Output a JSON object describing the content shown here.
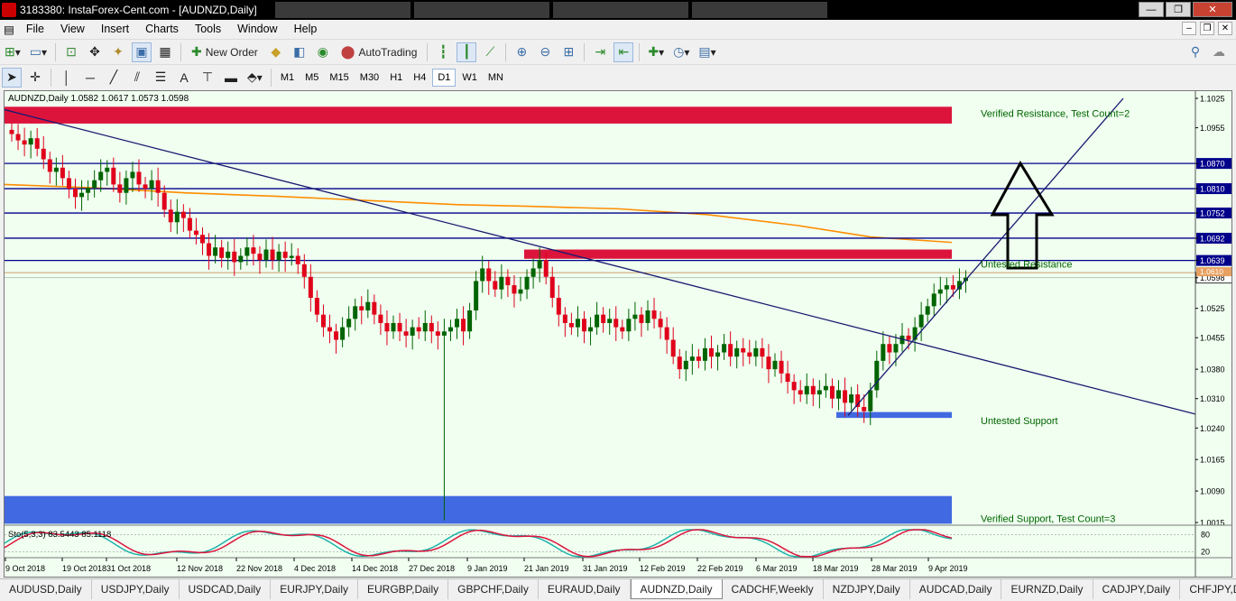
{
  "window": {
    "title": "3183380: InstaForex-Cent.com - [AUDNZD,Daily]",
    "minimize": "—",
    "restore": "❐",
    "close": "✕"
  },
  "menu": [
    "File",
    "View",
    "Insert",
    "Charts",
    "Tools",
    "Window",
    "Help"
  ],
  "toolbar": {
    "new_order": "New Order",
    "auto_trading": "AutoTrading"
  },
  "timeframes": [
    "M1",
    "M5",
    "M15",
    "M30",
    "H1",
    "H4",
    "D1",
    "W1",
    "MN"
  ],
  "selected_timeframe": "D1",
  "chart": {
    "header": "AUDNZD,Daily  1.0582 1.0617 1.0573 1.0598",
    "indicator": "Sto(5,3,3) 83.5443 85.1118",
    "price_labels": [
      "1.1025",
      "1.0955",
      "1.0870",
      "1.0810",
      "1.0752",
      "1.0692",
      "1.0639",
      "1.0598",
      "1.0525",
      "1.0455",
      "1.0380",
      "1.0310",
      "1.0240",
      "1.0165",
      "1.0090",
      "1.0015"
    ],
    "highlighted_levels": [
      "1.0870",
      "1.0810",
      "1.0752",
      "1.0692",
      "1.0639"
    ],
    "current_price": "1.0598",
    "bid_line": "1.0610",
    "date_labels": [
      "9 Oct 2018",
      "19 Oct 2018",
      "31 Oct 2018",
      "12 Nov 2018",
      "22 Nov 2018",
      "4 Dec 2018",
      "14 Dec 2018",
      "27 Dec 2018",
      "9 Jan 2019",
      "21 Jan 2019",
      "31 Jan 2019",
      "12 Feb 2019",
      "22 Feb 2019",
      "6 Mar 2019",
      "18 Mar 2019",
      "28 Mar 2019",
      "9 Apr 2019"
    ],
    "zone_labels": {
      "verified_resistance": "Verified Resistance, Test Count=2",
      "untested_resistance": "Untested Resistance",
      "untested_support": "Untested Support",
      "verified_support": "Verified Support, Test Count=3"
    },
    "stoch_levels": [
      "80",
      "20"
    ],
    "colors": {
      "background": "#f0fff0",
      "bull": "#006400",
      "bear": "#e0001b",
      "resistance_zone": "#dc143c",
      "support_zone": "#4169e1",
      "levels": "#00008b",
      "ma": "#ff8c00",
      "zone_text": "#006400"
    }
  },
  "symbol_tabs": [
    "AUDUSD,Daily",
    "USDJPY,Daily",
    "USDCAD,Daily",
    "EURJPY,Daily",
    "EURGBP,Daily",
    "GBPCHF,Daily",
    "EURAUD,Daily",
    "AUDNZD,Daily",
    "CADCHF,Weekly",
    "NZDJPY,Daily",
    "AUDCAD,Daily",
    "EURNZD,Daily",
    "CADJPY,Daily",
    "CHFJPY,Da"
  ],
  "selected_tab": "AUDNZD,Daily"
}
